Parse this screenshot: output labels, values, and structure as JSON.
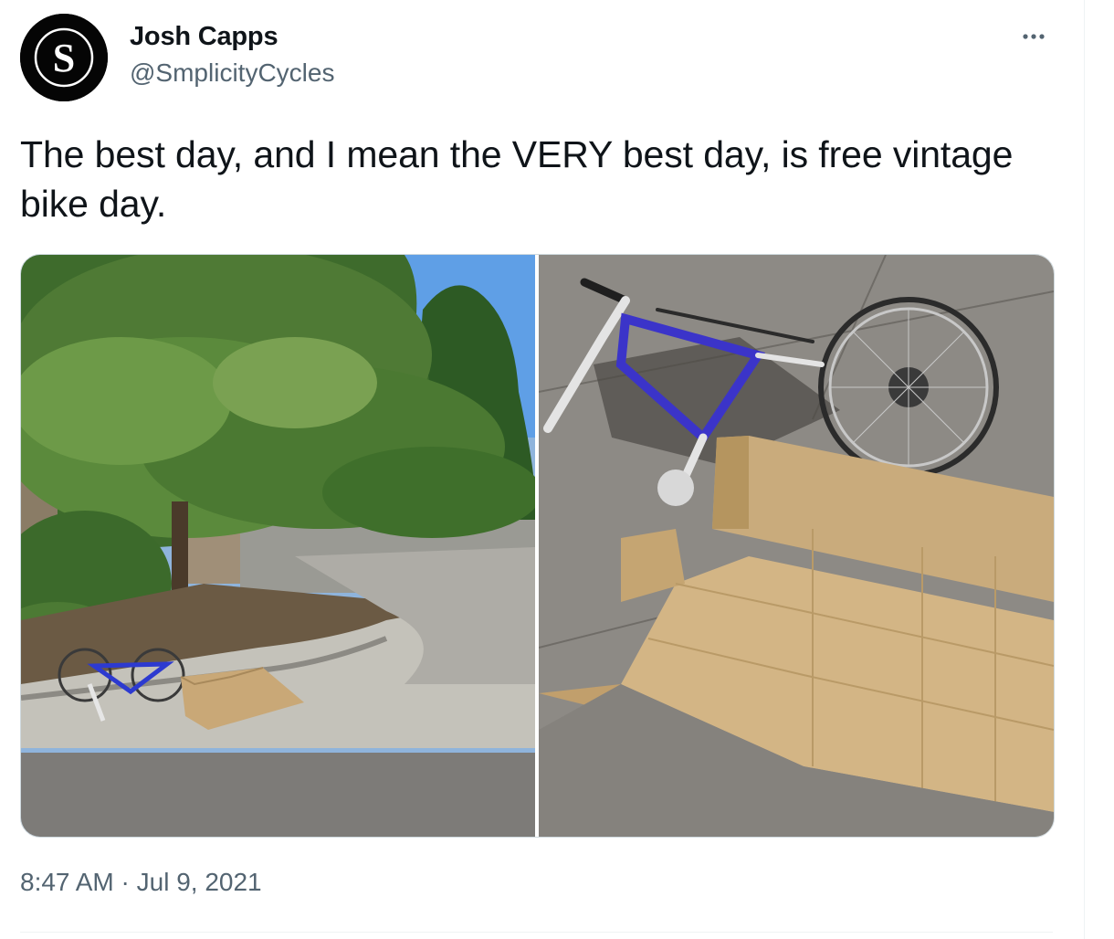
{
  "author": {
    "name": "Josh Capps",
    "handle": "@SmplicityCycles",
    "avatar_letter": "S"
  },
  "tweet": {
    "text": "The best day, and I mean the VERY best day, is free vintage bike day.",
    "time": "8:47 AM",
    "separator": "·",
    "date": "Jul 9, 2021"
  },
  "media": {
    "photos": [
      {
        "subject": "bike-on-curb-under-pine-tree"
      },
      {
        "subject": "bike-with-cardboard-box-on-sidewalk"
      }
    ]
  },
  "icons": {
    "more": "more-horizontal-icon"
  },
  "colors": {
    "text_primary": "#0f1419",
    "text_secondary": "#536471",
    "border": "#cfd9de",
    "avatar_bg": "#050505"
  }
}
